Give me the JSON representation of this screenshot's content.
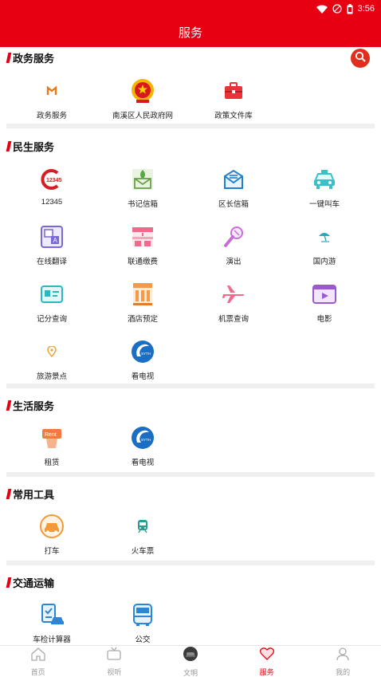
{
  "status_bar": {
    "time": "3:56"
  },
  "header": {
    "title": "服务"
  },
  "sections": [
    {
      "title": "政务服务",
      "items": [
        {
          "label": "政务服务",
          "icon": "gov-service-icon"
        },
        {
          "label": "南溪区人民政府网",
          "icon": "national-emblem-icon"
        },
        {
          "label": "政策文件库",
          "icon": "briefcase-icon"
        }
      ]
    },
    {
      "title": "民生服务",
      "items": [
        {
          "label": "12345",
          "icon": "hotline-12345-icon"
        },
        {
          "label": "书记信箱",
          "icon": "secretary-mailbox-icon"
        },
        {
          "label": "区长信箱",
          "icon": "mayor-mailbox-icon"
        },
        {
          "label": "一键叫车",
          "icon": "taxi-icon"
        },
        {
          "label": "在线翻译",
          "icon": "translate-icon"
        },
        {
          "label": "联通缴费",
          "icon": "payment-icon"
        },
        {
          "label": "演出",
          "icon": "microphone-icon"
        },
        {
          "label": "国内游",
          "icon": "beach-umbrella-icon"
        },
        {
          "label": "记分查询",
          "icon": "license-card-icon"
        },
        {
          "label": "酒店预定",
          "icon": "hotel-icon"
        },
        {
          "label": "机票查询",
          "icon": "airplane-icon"
        },
        {
          "label": "电影",
          "icon": "film-icon"
        },
        {
          "label": "旅游景点",
          "icon": "location-pin-icon"
        },
        {
          "label": "看电视",
          "icon": "tv-logo-icon"
        }
      ]
    },
    {
      "title": "生活服务",
      "items": [
        {
          "label": "租赁",
          "icon": "rent-sign-icon",
          "sign_text": "Rent"
        },
        {
          "label": "看电视",
          "icon": "tv-logo-icon"
        }
      ]
    },
    {
      "title": "常用工具",
      "items": [
        {
          "label": "打车",
          "icon": "car-badge-icon"
        },
        {
          "label": "火车票",
          "icon": "train-icon"
        }
      ]
    },
    {
      "title": "交通运输",
      "items": [
        {
          "label": "车检计算器",
          "icon": "car-inspection-icon"
        },
        {
          "label": "公交",
          "icon": "bus-icon"
        }
      ]
    }
  ],
  "tabbar": [
    {
      "label": "首页",
      "icon": "home-icon",
      "active": false
    },
    {
      "label": "视听",
      "icon": "tv-icon",
      "active": false
    },
    {
      "label": "文明",
      "icon": "civilization-avatar-icon",
      "active": false
    },
    {
      "label": "服务",
      "icon": "heart-icon",
      "active": true
    },
    {
      "label": "我的",
      "icon": "user-icon",
      "active": false
    }
  ],
  "colors": {
    "brand_red": "#e60012",
    "inactive_tab": "#999999",
    "divider": "#efefef"
  }
}
